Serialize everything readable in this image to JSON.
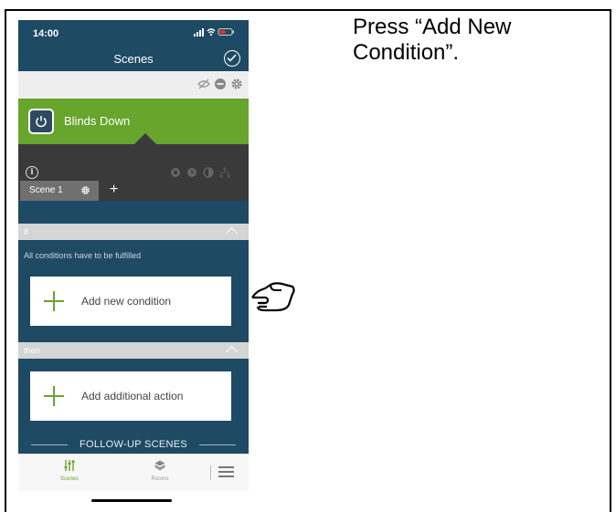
{
  "instruction": "Press “Add New Condition”.",
  "status_bar": {
    "time": "14:00",
    "icons": "signal-wifi-battery"
  },
  "nav": {
    "title": "Scenes",
    "confirm_icon": "check-circle-icon"
  },
  "toolbar": {
    "icons": [
      "eye-off-icon",
      "minus-circle-icon",
      "gear-icon"
    ]
  },
  "scene": {
    "name": "Blinds Down",
    "power_icon": "power-icon"
  },
  "panel": {
    "icons": [
      "info-icon",
      "record-icon",
      "clock-icon",
      "contrast-icon",
      "network-icon"
    ]
  },
  "tabs": {
    "active": "Scene 1",
    "add_label": "+"
  },
  "if_section": {
    "label": "If",
    "note": "All conditions have to be fulfilled",
    "add_button": "Add new condition"
  },
  "then_section": {
    "label": "then",
    "add_button": "Add additional action"
  },
  "follow_up": "FOLLOW-UP SCENES",
  "tab_bar": {
    "scenes": "Scenes",
    "rooms": "Rooms",
    "menu_icon": "hamburger-icon"
  },
  "colors": {
    "navy": "#1e4a64",
    "green": "#67a52d",
    "dark_panel": "#3a3a3a"
  }
}
